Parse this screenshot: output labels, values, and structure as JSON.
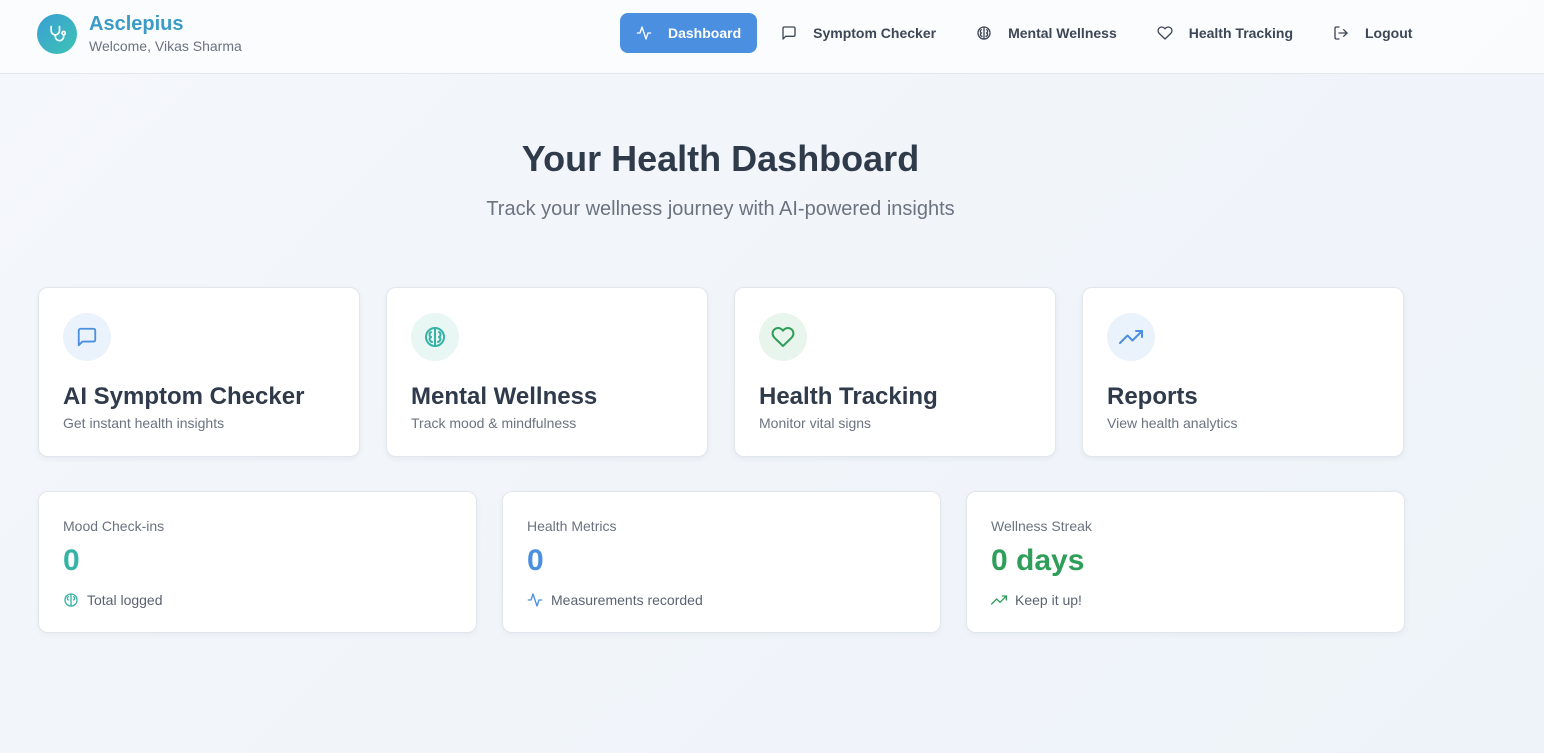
{
  "app": {
    "name": "Asclepius",
    "welcome": "Welcome, Vikas Sharma",
    "logo_icon": "stethoscope-icon"
  },
  "nav": {
    "items": [
      {
        "label": "Dashboard",
        "icon": "activity-icon",
        "active": true
      },
      {
        "label": "Symptom Checker",
        "icon": "message-square-icon",
        "active": false
      },
      {
        "label": "Mental Wellness",
        "icon": "brain-icon",
        "active": false
      },
      {
        "label": "Health Tracking",
        "icon": "heart-icon",
        "active": false
      },
      {
        "label": "Logout",
        "icon": "logout-icon",
        "active": false
      }
    ]
  },
  "hero": {
    "title": "Your Health Dashboard",
    "subtitle": "Track your wellness journey with AI-powered insights"
  },
  "cards": [
    {
      "title": "AI Symptom Checker",
      "desc": "Get instant health insights",
      "icon": "message-square-icon",
      "color": "#4a8fe0",
      "bg": "#eaf2fb"
    },
    {
      "title": "Mental Wellness",
      "desc": "Track mood & mindfulness",
      "icon": "brain-icon",
      "color": "#36b3a4",
      "bg": "#e8f6f4"
    },
    {
      "title": "Health Tracking",
      "desc": "Monitor vital signs",
      "icon": "heart-icon",
      "color": "#2f9e5a",
      "bg": "#e7f5ec"
    },
    {
      "title": "Reports",
      "desc": "View health analytics",
      "icon": "trending-up-icon",
      "color": "#4a8fe0",
      "bg": "#eaf2fb"
    }
  ],
  "stats": [
    {
      "label": "Mood Check-ins",
      "value": "0",
      "note": "Total logged",
      "icon": "brain-icon",
      "color": "#36b3a4"
    },
    {
      "label": "Health Metrics",
      "value": "0",
      "note": "Measurements recorded",
      "icon": "activity-icon",
      "color": "#4a8fe0"
    },
    {
      "label": "Wellness Streak",
      "value": "0 days",
      "note": "Keep it up!",
      "icon": "trending-up-icon",
      "color": "#2f9e5a"
    }
  ]
}
